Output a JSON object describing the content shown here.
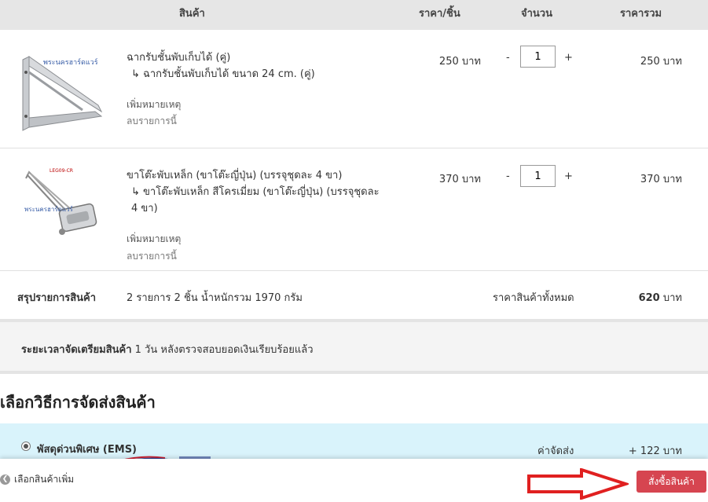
{
  "header": {
    "product": "สินค้า",
    "price": "ราคา/ชิ้น",
    "qty": "จำนวน",
    "total": "ราคารวม"
  },
  "items": [
    {
      "name": "ฉากรับชั้นพับเก็บได้ (คู่)",
      "variant": "↳ ฉากรับชั้นพับเก็บได้ ขนาด 24 cm. (คู่)",
      "note_label": "เพิ่มหมายเหตุ",
      "remove_label": "ลบรายการนี้",
      "price": "250 บาท",
      "qty": "1",
      "total": "250 บาท",
      "watermark": "พระนครฮาร์ดแวร์"
    },
    {
      "name": "ขาโต๊ะพับเหล็ก (ขาโต๊ะญี่ปุ่น) (บรรจุชุดละ 4 ขา)",
      "variant": "↳ ขาโต๊ะพับเหล็ก สีโครเมี่ยม (ขาโต๊ะญี่ปุ่น) (บรรจุชุดละ 4 ขา)",
      "note_label": "เพิ่มหมายเหตุ",
      "remove_label": "ลบรายการนี้",
      "price": "370 บาท",
      "qty": "1",
      "total": "370 บาท",
      "watermark": "พระนครฮาร์ดแวร์",
      "code": "LEG09-CR"
    }
  ],
  "qty_controls": {
    "minus": "-",
    "plus": "+"
  },
  "summary": {
    "label": "สรุปรายการสินค้า",
    "detail": "2 รายการ 2 ชิ้น น้ำหนักรวม 1970 กรัม",
    "total_label": "ราคาสินค้าทั้งหมด",
    "total_value": "620",
    "total_unit": "บาท"
  },
  "prep": {
    "label": "ระยะเวลาจัดเตรียมสินค้า",
    "text": "1 วัน หลังตรวจสอบยอดเงินเรียบร้อยแล้ว"
  },
  "shipping": {
    "title": "เลือกวิธีการจัดส่งสินค้า",
    "option_name": "พัสดุด่วนพิเศษ (EMS)",
    "fee_label": "ค่าจัดส่ง",
    "fee_value": "+ 122 บาท"
  },
  "footer": {
    "back_label": "เลือกสินค้าเพิ่ม",
    "order_label": "สั่งซื้อสินค้า"
  },
  "colors": {
    "header_bg": "#e6e6e6",
    "ship_bg": "#d9f3fb",
    "order_button": "#d64550",
    "arrow": "#e02020"
  }
}
